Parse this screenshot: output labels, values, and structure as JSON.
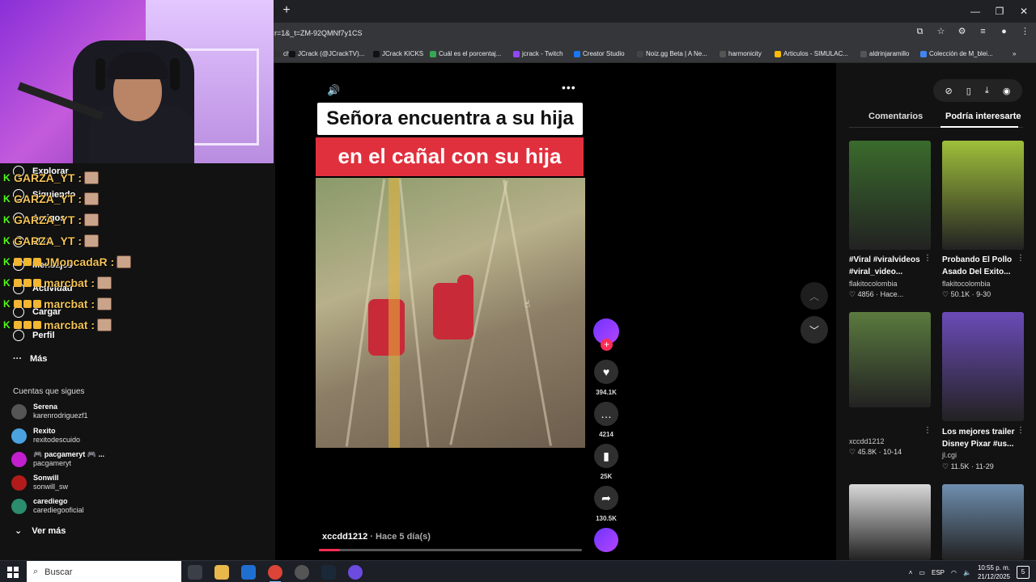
{
  "browser": {
    "url": "r=1&_t=ZM-92QMNf7y1CS",
    "new_tab": "+",
    "bookmarks": [
      {
        "label": "ch",
        "color": "#333"
      },
      {
        "label": "JCrack (@JCrackTV)...",
        "color": "#111"
      },
      {
        "label": "JCrack KICKS",
        "color": "#111"
      },
      {
        "label": "Cuál es el porcentaj...",
        "color": "#34a853"
      },
      {
        "label": "jcrack - Twitch",
        "color": "#9146ff"
      },
      {
        "label": "Creator Studio",
        "color": "#1877f2"
      },
      {
        "label": "Noiz.gg Beta | A Ne...",
        "color": "#444"
      },
      {
        "label": "harmonicity",
        "color": "#555"
      },
      {
        "label": "Articulos - SIMULAC...",
        "color": "#fbbc05"
      },
      {
        "label": "aldrinjaramillo",
        "color": "#555"
      },
      {
        "label": "Colección de M_blei...",
        "color": "#4285f4"
      }
    ],
    "more_bookmarks": "»"
  },
  "nav": {
    "items": [
      {
        "label": "Explorar"
      },
      {
        "label": "Siguiendo"
      },
      {
        "label": "Amigos"
      },
      {
        "label": "LIVE"
      },
      {
        "label": "Mensajes"
      },
      {
        "label": "Actividad"
      },
      {
        "label": "Cargar"
      },
      {
        "label": "Perfil"
      }
    ],
    "more": "Más",
    "following_title": "Cuentas que sigues",
    "accounts": [
      {
        "name": "Serena",
        "handle": "karenrodriguezf1",
        "color": "#555"
      },
      {
        "name": "Rexito",
        "handle": "rexitodescuido",
        "color": "#4aa3df"
      },
      {
        "name": "🎮 pacgameryt 🎮 ...",
        "handle": "pacgameryt",
        "color": "#c21fcf"
      },
      {
        "name": "Sonwill",
        "handle": "sonwill_sw",
        "color": "#b31b1b"
      },
      {
        "name": "carediego",
        "handle": "carediegooficial",
        "color": "#2b8c6e"
      }
    ],
    "see_more": "Ver más"
  },
  "chat": [
    {
      "user": "GARZA_YT :"
    },
    {
      "user": "GARZA_YT :"
    },
    {
      "user": "GARZA_YT :"
    },
    {
      "user": "GARZA_YT :"
    },
    {
      "user": "JMoncadaR :"
    },
    {
      "user": "marcbat :"
    },
    {
      "user": "marcbat :"
    },
    {
      "user": "marcbat :"
    }
  ],
  "video": {
    "caption_top": "Señora encuentra a su hija",
    "caption_bottom": "en el cañal con su hija",
    "author": "xccdd1212",
    "time_ago": "· Hace 5 día(s)",
    "progress": 0.08,
    "likes": "394.1K",
    "comments": "4214",
    "saves": "25K",
    "shares": "130.5K"
  },
  "right": {
    "tab_comments": "Comentarios",
    "tab_interest": "Podría interesarte",
    "cards": [
      {
        "title": "#Viral #viralvideos #viral_video...",
        "author": "flakitocolombia",
        "stats": "♡ 4856 · Hace...",
        "color": "#3a6b2c"
      },
      {
        "title": "Probando El Pollo Asado Del Exito...",
        "author": "flakitocolombia",
        "stats": "♡ 50.1K · 9-30",
        "color": "#9fbf3a"
      },
      {
        "title": "",
        "author": "xccdd1212",
        "stats": "♡ 45.8K · 10-14",
        "color": "#5a7a3e"
      },
      {
        "title": "Los mejores trailer Disney Pixar #us...",
        "author": "jl.cgi",
        "stats": "♡ 11.5K · 11-29",
        "color": "#6b4bb8"
      },
      {
        "title": "",
        "author": "",
        "stats": "",
        "color": "#d9d9d9"
      },
      {
        "title": "",
        "author": "",
        "stats": "",
        "color": "#6f8fb0"
      }
    ]
  },
  "taskbar": {
    "search_placeholder": "Buscar",
    "lang": "ESP",
    "time": "10:55 p. m.",
    "date": "21/12/2025",
    "notifications": "5"
  }
}
